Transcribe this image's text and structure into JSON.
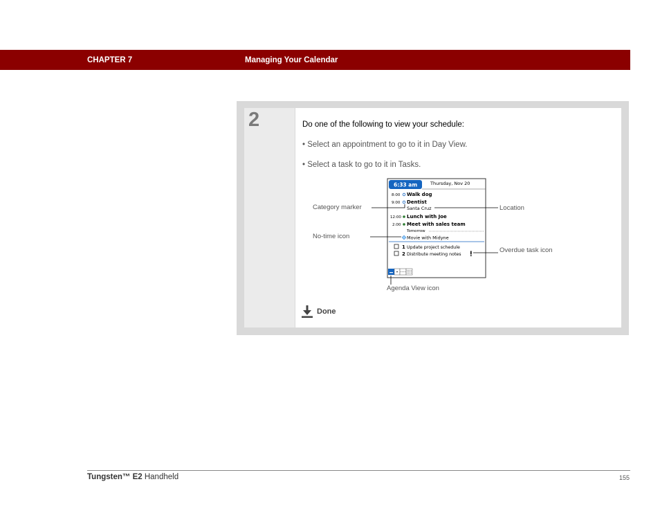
{
  "header": {
    "chapter": "CHAPTER 7",
    "title": "Managing Your Calendar"
  },
  "step": {
    "number": "2",
    "intro": "Do one of the following to view your schedule:",
    "bullets": [
      "•  Select an appointment to go to it in Day View.",
      "•  Select a task to go to it in Tasks."
    ],
    "done_label": "Done"
  },
  "figure": {
    "callouts": {
      "category_marker": "Category marker",
      "no_time_icon": "No-time icon",
      "location": "Location",
      "overdue_task_icon": "Overdue task icon",
      "agenda_view_icon": "Agenda View icon"
    },
    "screen": {
      "time": "6:33 am",
      "date": "Thursday, Nov 20",
      "appointments": [
        {
          "time": "8:00",
          "title": "Walk dog"
        },
        {
          "time": "9:00",
          "title": "Dentist"
        },
        {
          "time": "",
          "title": "Santa Cruz"
        },
        {
          "time": "12:00",
          "title": "Lunch with Joe"
        },
        {
          "time": "2:00",
          "title": "Meet with sales team"
        }
      ],
      "tomorrow_label": "Tomorrow",
      "no_time_event": "Movie with Midyne",
      "tasks": [
        {
          "priority": "1",
          "title": "Update project schedule",
          "overdue": false
        },
        {
          "priority": "2",
          "title": "Distribute meeting notes",
          "overdue": true
        }
      ]
    }
  },
  "footer": {
    "product_prefix": "Tungsten™ E2",
    "product_suffix": " Handheld",
    "page_number": "155"
  }
}
